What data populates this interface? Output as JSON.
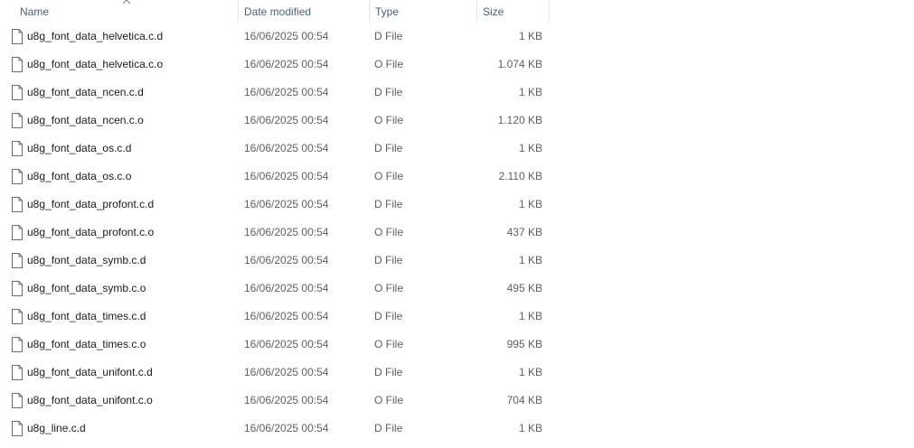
{
  "columns": {
    "name": "Name",
    "date": "Date modified",
    "type": "Type",
    "size": "Size"
  },
  "sort_indicator": "chevron-up-icon",
  "file_icon": "document-icon",
  "files": [
    {
      "name": "u8g_font_data_helvetica.c.d",
      "date": "16/06/2025 00:54",
      "type": "D File",
      "size": "1 KB"
    },
    {
      "name": "u8g_font_data_helvetica.c.o",
      "date": "16/06/2025 00:54",
      "type": "O File",
      "size": "1.074 KB"
    },
    {
      "name": "u8g_font_data_ncen.c.d",
      "date": "16/06/2025 00:54",
      "type": "D File",
      "size": "1 KB"
    },
    {
      "name": "u8g_font_data_ncen.c.o",
      "date": "16/06/2025 00:54",
      "type": "O File",
      "size": "1.120 KB"
    },
    {
      "name": "u8g_font_data_os.c.d",
      "date": "16/06/2025 00:54",
      "type": "D File",
      "size": "1 KB"
    },
    {
      "name": "u8g_font_data_os.c.o",
      "date": "16/06/2025 00:54",
      "type": "O File",
      "size": "2.110 KB"
    },
    {
      "name": "u8g_font_data_profont.c.d",
      "date": "16/06/2025 00:54",
      "type": "D File",
      "size": "1 KB"
    },
    {
      "name": "u8g_font_data_profont.c.o",
      "date": "16/06/2025 00:54",
      "type": "O File",
      "size": "437 KB"
    },
    {
      "name": "u8g_font_data_symb.c.d",
      "date": "16/06/2025 00:54",
      "type": "D File",
      "size": "1 KB"
    },
    {
      "name": "u8g_font_data_symb.c.o",
      "date": "16/06/2025 00:54",
      "type": "O File",
      "size": "495 KB"
    },
    {
      "name": "u8g_font_data_times.c.d",
      "date": "16/06/2025 00:54",
      "type": "D File",
      "size": "1 KB"
    },
    {
      "name": "u8g_font_data_times.c.o",
      "date": "16/06/2025 00:54",
      "type": "O File",
      "size": "995 KB"
    },
    {
      "name": "u8g_font_data_unifont.c.d",
      "date": "16/06/2025 00:54",
      "type": "D File",
      "size": "1 KB"
    },
    {
      "name": "u8g_font_data_unifont.c.o",
      "date": "16/06/2025 00:54",
      "type": "O File",
      "size": "704 KB"
    },
    {
      "name": "u8g_line.c.d",
      "date": "16/06/2025 00:54",
      "type": "D File",
      "size": "1 KB"
    }
  ]
}
